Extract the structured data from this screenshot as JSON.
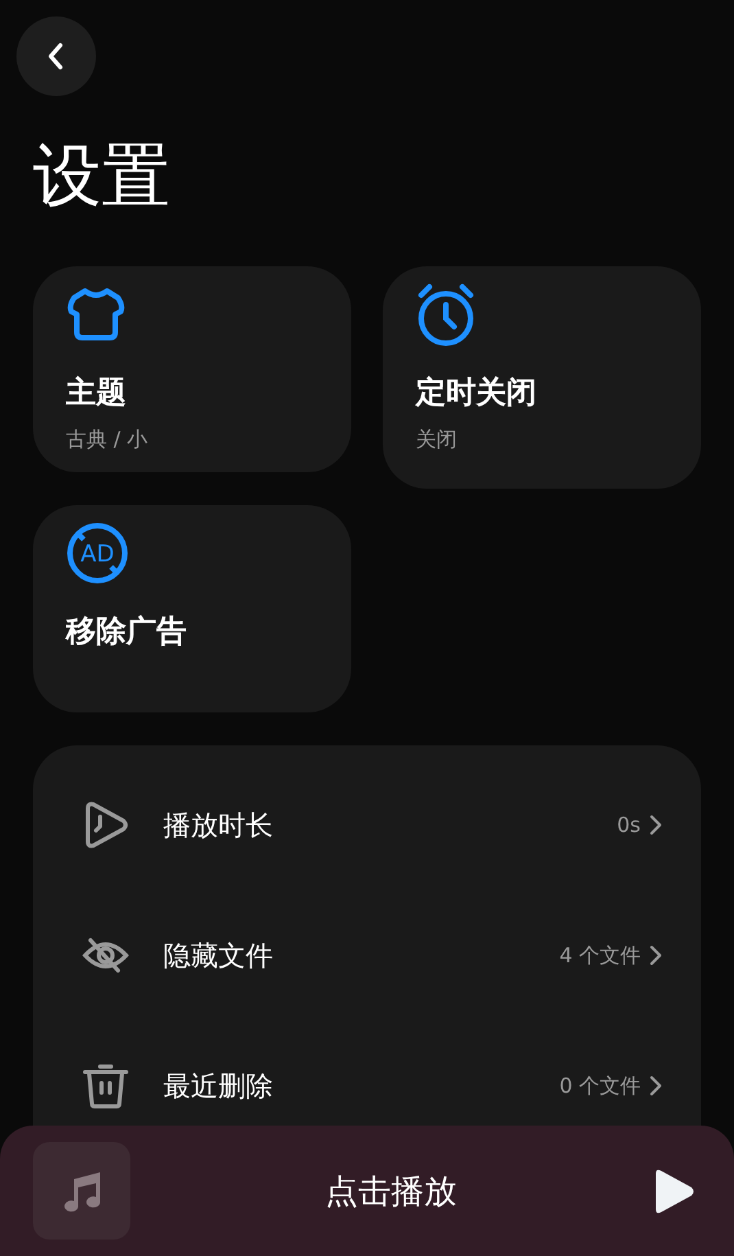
{
  "title": "设置",
  "cards": [
    {
      "kind": "theme",
      "title": "主题",
      "subtitle": "古典 / 小"
    },
    {
      "kind": "timer",
      "title": "定时关闭",
      "subtitle": "关闭"
    },
    {
      "kind": "ads",
      "title": "移除广告",
      "icon_text": "AD"
    }
  ],
  "rows": [
    {
      "kind": "duration",
      "label": "播放时长",
      "value": "0s"
    },
    {
      "kind": "hidden",
      "label": "隐藏文件",
      "value": "4 个文件"
    },
    {
      "kind": "trash",
      "label": "最近删除",
      "value": "0 个文件"
    }
  ],
  "player": {
    "text": "点击播放"
  }
}
